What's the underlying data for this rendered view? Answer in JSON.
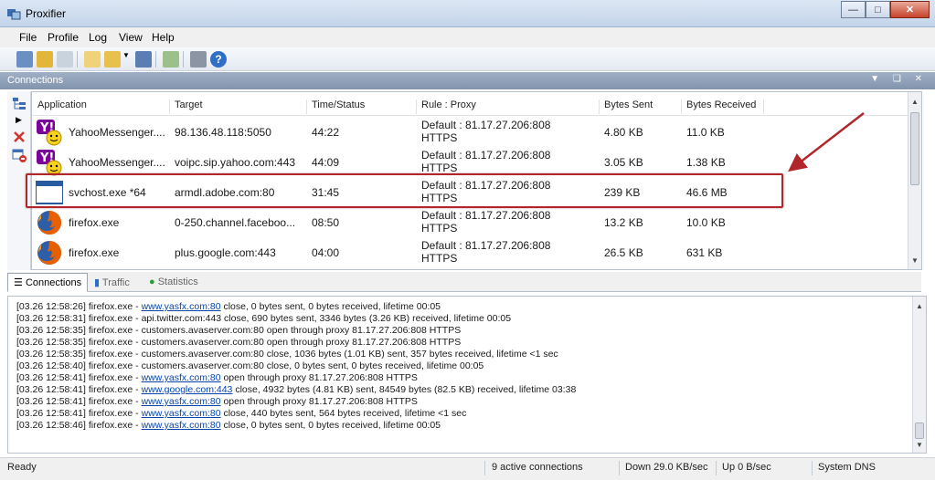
{
  "window": {
    "title": "Proxifier"
  },
  "menu": [
    "File",
    "Profile",
    "Log",
    "View",
    "Help"
  ],
  "panel": {
    "title": "Connections"
  },
  "table": {
    "columns": [
      "Application",
      "Target",
      "Time/Status",
      "Rule : Proxy",
      "Bytes Sent",
      "Bytes Received"
    ],
    "rows": [
      {
        "app": "YahooMessenger....",
        "icon": "yahoo-messenger-icon",
        "target": "98.136.48.118:5050",
        "time": "44:22",
        "rule_line1": "Default : 81.17.27.206:808",
        "rule_line2": "HTTPS",
        "sent": "4.80 KB",
        "received": "11.0 KB"
      },
      {
        "app": "YahooMessenger....",
        "icon": "yahoo-messenger-icon",
        "target": "voipc.sip.yahoo.com:443",
        "time": "44:09",
        "rule_line1": "Default : 81.17.27.206:808",
        "rule_line2": "HTTPS",
        "sent": "3.05 KB",
        "received": "1.38 KB"
      },
      {
        "app": "svchost.exe *64",
        "icon": "window-app-icon",
        "target": "armdl.adobe.com:80",
        "time": "31:45",
        "rule_line1": "Default : 81.17.27.206:808",
        "rule_line2": "HTTPS",
        "sent": "239 KB",
        "received": "46.6 MB"
      },
      {
        "app": "firefox.exe",
        "icon": "firefox-icon",
        "target": "0-250.channel.faceboo...",
        "time": "08:50",
        "rule_line1": "Default : 81.17.27.206:808",
        "rule_line2": "HTTPS",
        "sent": "13.2 KB",
        "received": "10.0 KB"
      },
      {
        "app": "firefox.exe",
        "icon": "firefox-icon",
        "target": "plus.google.com:443",
        "time": "04:00",
        "rule_line1": "Default : 81.17.27.206:808",
        "rule_line2": "HTTPS",
        "sent": "26.5 KB",
        "received": "631 KB"
      }
    ]
  },
  "tabs": [
    "Connections",
    "Traffic",
    "Statistics"
  ],
  "log": [
    {
      "pre": "[03.26 12:58:26] firefox.exe - ",
      "link": "www.yasfx.com:80",
      "post": " close, 0 bytes sent, 0 bytes received, lifetime 00:05"
    },
    {
      "pre": "[03.26 12:58:31] firefox.exe - api.twitter.com:443 close, 690 bytes sent, 3346 bytes (3.26 KB) received, lifetime 00:05",
      "link": "",
      "post": ""
    },
    {
      "pre": "[03.26 12:58:35] firefox.exe - customers.avaserver.com:80 open through proxy 81.17.27.206:808 HTTPS",
      "link": "",
      "post": ""
    },
    {
      "pre": "[03.26 12:58:35] firefox.exe - customers.avaserver.com:80 open through proxy 81.17.27.206:808 HTTPS",
      "link": "",
      "post": ""
    },
    {
      "pre": "[03.26 12:58:35] firefox.exe - customers.avaserver.com:80 close, 1036 bytes (1.01 KB) sent, 357 bytes received, lifetime <1 sec",
      "link": "",
      "post": ""
    },
    {
      "pre": "[03.26 12:58:40] firefox.exe - customers.avaserver.com:80 close, 0 bytes sent, 0 bytes received, lifetime 00:05",
      "link": "",
      "post": ""
    },
    {
      "pre": "[03.26 12:58:41] firefox.exe - ",
      "link": "www.yasfx.com:80",
      "post": " open through proxy 81.17.27.206:808 HTTPS"
    },
    {
      "pre": "[03.26 12:58:41] firefox.exe - ",
      "link": "www.google.com:443",
      "post": " close, 4932 bytes (4.81 KB) sent, 84549 bytes (82.5 KB) received, lifetime 03:38"
    },
    {
      "pre": "[03.26 12:58:41] firefox.exe - ",
      "link": "www.yasfx.com:80",
      "post": " open through proxy 81.17.27.206:808 HTTPS"
    },
    {
      "pre": "[03.26 12:58:41] firefox.exe - ",
      "link": "www.yasfx.com:80",
      "post": " close, 440 bytes sent, 564 bytes received, lifetime <1 sec"
    },
    {
      "pre": "[03.26 12:58:46] firefox.exe - ",
      "link": "www.yasfx.com:80",
      "post": " close, 0 bytes sent, 0 bytes received, lifetime 00:05"
    }
  ],
  "status": {
    "ready": "Ready",
    "active": "9 active connections",
    "down": "Down 29.0 KB/sec",
    "up": "Up 0 B/sec",
    "dns": "System DNS"
  },
  "colors": {
    "highlight": "#b0262b",
    "link": "#0645ad",
    "panel_header": "#8fa1b9"
  }
}
